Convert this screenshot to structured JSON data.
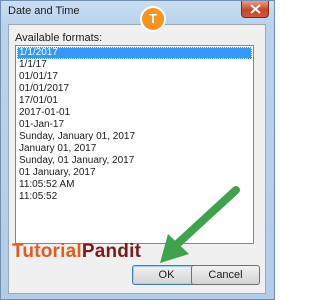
{
  "window": {
    "title": "Date and Time",
    "close_icon": "close-icon"
  },
  "logo": {
    "glyph": "T"
  },
  "formats": {
    "label": "Available formats:",
    "selected_index": 0,
    "items": [
      "1/1/2017",
      "1/1/17",
      "01/01/17",
      "01/01/2017",
      "17/01/01",
      "2017-01-01",
      "01-Jan-17",
      "Sunday, January 01, 2017",
      "January 01, 2017",
      "Sunday, 01 January, 2017",
      "01 January, 2017",
      "11:05:52 AM",
      "11:05:52"
    ]
  },
  "watermark": {
    "part1": "Tutorial",
    "part2": "Pandit"
  },
  "buttons": {
    "ok": "OK",
    "cancel": "Cancel"
  },
  "colors": {
    "selection": "#3399ff",
    "arrow": "#3fa34d",
    "brand_orange": "#e35c1f",
    "brand_maroon": "#7b1c1c"
  }
}
